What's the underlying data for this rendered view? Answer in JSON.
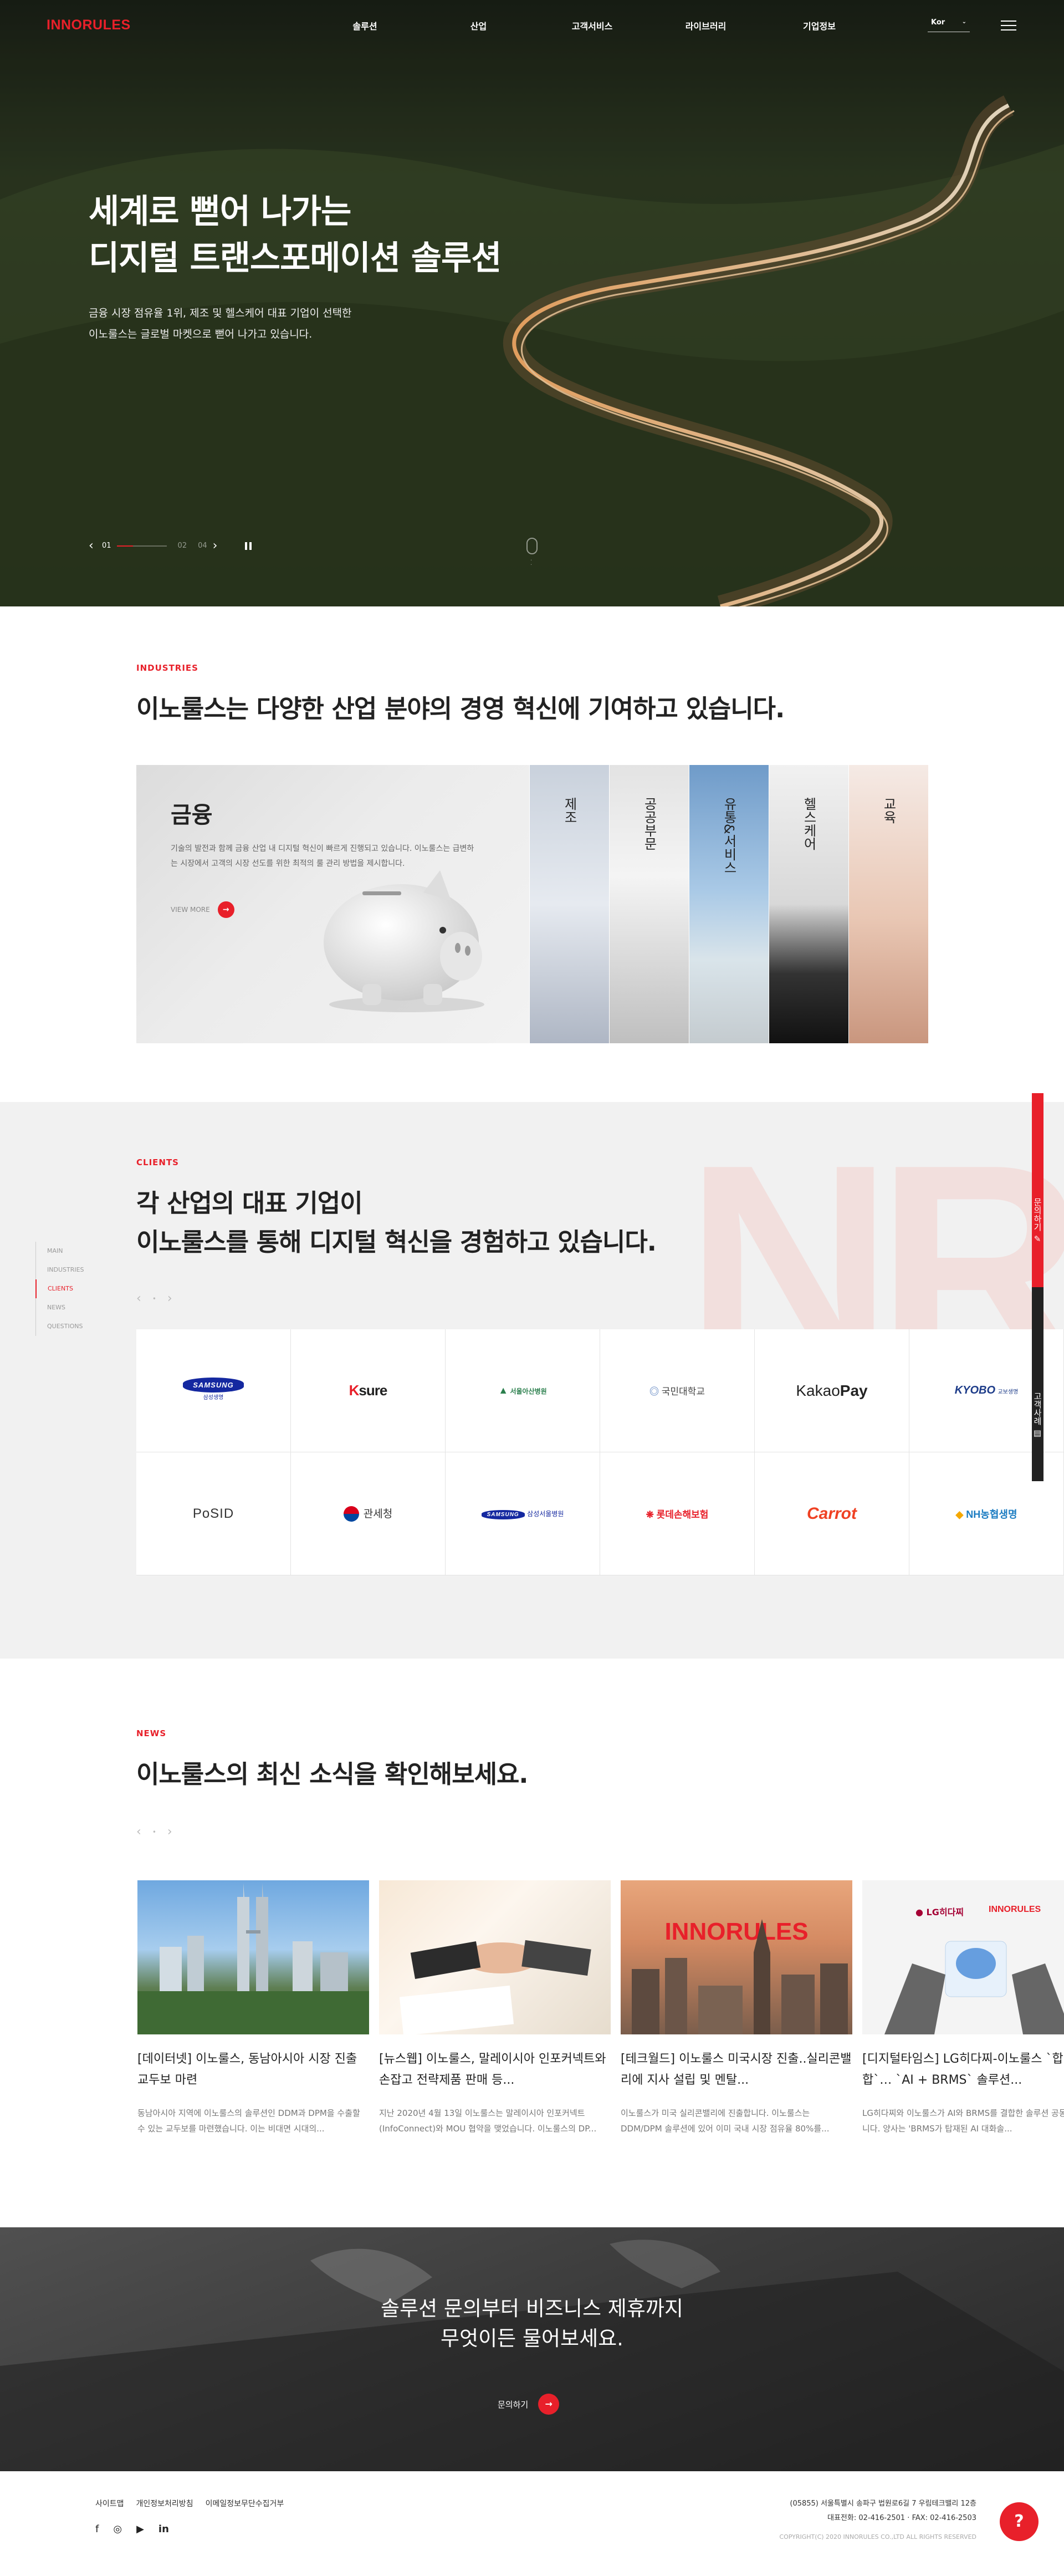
{
  "header": {
    "logo": "INNORULES",
    "nav": [
      "솔루션",
      "산업",
      "고객서비스",
      "라이브러리",
      "기업정보"
    ],
    "lang": "Kor"
  },
  "hero": {
    "title_line1": "세계로 뻗어 나가는",
    "title_line2": "디지털 트랜스포메이션 솔루션",
    "desc_line1": "금융 시장 점유율 1위, 제조 및 헬스케어 대표 기업이 선택한",
    "desc_line2": "이노룰스는 글로벌 마켓으로 뻗어 나가고 있습니다.",
    "slide_current": "01",
    "slide_total": "04",
    "slide_next": "02",
    "slide_progress": 0.33
  },
  "industries": {
    "tag": "INDUSTRIES",
    "title": "이노룰스는 다양한 산업 분야의 경영 혁신에 기여하고 있습니다.",
    "active": {
      "name": "금융",
      "desc": "기술의 발전과 함께 금융 산업 내 디지털 혁신이 빠르게 진행되고 있습니다. 이노룰스는 급변하는 시장에서 고객의 시장 선도를 위한 최적의 룰 관리 방법을 제시합니다.",
      "more": "VIEW MORE"
    },
    "items": [
      "제조",
      "공공부문",
      "유통&서비스",
      "헬스케어",
      "교육"
    ]
  },
  "clients": {
    "tag": "CLIENTS",
    "title_line1": "각 산업의 대표 기업이",
    "title_line2": "이노룰스를 통해 디지털 혁신을 경험하고 있습니다.",
    "side_nav": [
      "MAIN",
      "INDUSTRIES",
      "CLIENTS",
      "NEWS",
      "QUESTIONS"
    ],
    "side_nav_active": 2,
    "logos": {
      "samsung_life": "SAMSUNG",
      "samsung_life_sub": "삼성생명",
      "ksure_k": "K",
      "ksure_rest": "sure",
      "seoul_asan": "서울아산병원",
      "kookmin": "국민대학교",
      "kakao_a": "Kakao",
      "kakao_b": "Pay",
      "kyobo": "KYOBO",
      "kyobo_sub": "교보생명",
      "posid": "PoSID",
      "customs": "관세청",
      "samsung_fire": "SAMSUNG",
      "samsung_fire_sub": "삼성서울병원",
      "lotte": "롯데손해보험",
      "carrot": "Carrot",
      "nh": "NH농협생명"
    }
  },
  "floating": {
    "inquiry": "문의하기",
    "cases": "고객사례"
  },
  "news": {
    "tag": "NEWS",
    "title": "이노룰스의 최신 소식을 확인해보세요.",
    "items": [
      {
        "title": "[데이터넷] 이노룰스, 동남아시아 시장 진출 교두보 마련",
        "desc": "동남아시아 지역에 이노룰스의 솔루션인 DDM과 DPM을 수출할 수 있는 교두보를 마련했습니다. 이는 비대면 시대의..."
      },
      {
        "title": "[뉴스웹] 이노룰스, 말레이시아 인포커넥트와 손잡고 전략제품 판매 등...",
        "desc": "지난 2020년 4월 13일 이노룰스는 말레이시아 인포커넥트(InfoConnect)와 MOU 협약을 맺었습니다. 이노룰스의 DP..."
      },
      {
        "title": "[테크월드] 이노룰스 미국시장 진출..실리콘밸리에 지사 설립 및 멘탈...",
        "desc": "이노룰스가 미국 실리콘밸리에 진출합니다. 이노룰스는 DDM/DPM 솔루션에 있어 이미 국내 시장 점유율 80%를..."
      },
      {
        "title": "[디지털타임스] LG히다찌-이노룰스 `합의투합`… `AI + BRMS` 솔루션...",
        "desc": "LG히다찌와 이노룰스가 AI와 BRMS를 결합한 솔루션 공동개발합니다. 양사는 'BRMS가 탑재된 AI 대화솔..."
      }
    ],
    "img_brand": "INNORULES",
    "lg_brand": "LG히다찌",
    "lg_partner": "INNORULES"
  },
  "cta": {
    "line1": "솔루션 문의부터 비즈니스 제휴까지",
    "line2": "무엇이든 물어보세요.",
    "button": "문의하기"
  },
  "footer": {
    "links": [
      "사이트맵",
      "개인정보처리방침",
      "이메일정보무단수집거부"
    ],
    "address": "(05855) 서울특별시 송파구 법원로6길 7 우림테크밸리 12층",
    "phone": "대표전화: 02-416-2501  ·  FAX: 02-416-2503",
    "copyright": "COPYRIGHT(C) 2020 INNORULES CO.,LTD ALL RIGHTS RESERVED"
  },
  "colors": {
    "accent": "#e8202a",
    "dark": "#222222",
    "gray_bg": "#f1f1f1"
  }
}
